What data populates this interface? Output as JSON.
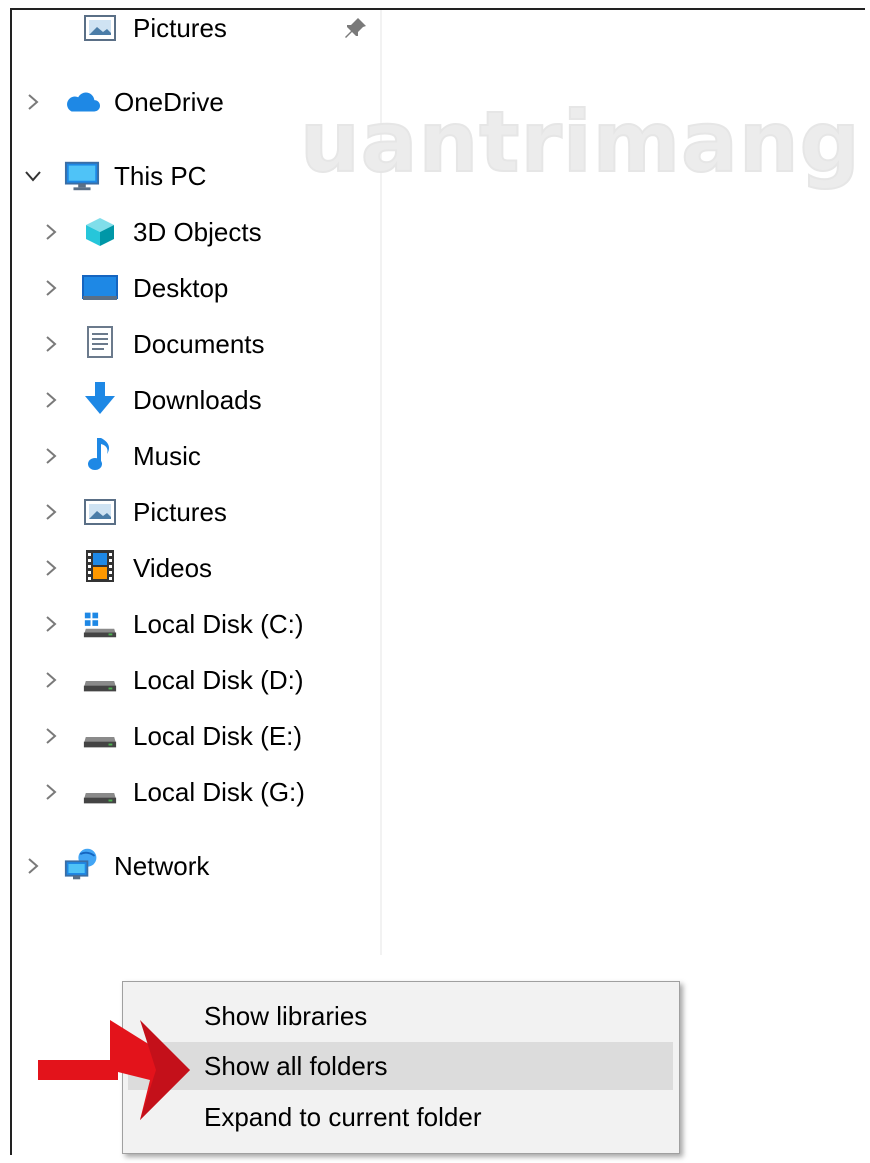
{
  "tree": {
    "items": [
      {
        "label": "Pictures",
        "icon": "pictures-icon",
        "pinned": true
      },
      {
        "label": "OneDrive",
        "icon": "onedrive-cloud-icon",
        "expanded": false
      },
      {
        "label": "This PC",
        "icon": "this-pc-icon",
        "expanded": true
      },
      {
        "label": "3D Objects",
        "icon": "3d-objects-icon"
      },
      {
        "label": "Desktop",
        "icon": "desktop-icon"
      },
      {
        "label": "Documents",
        "icon": "documents-icon"
      },
      {
        "label": "Downloads",
        "icon": "downloads-icon"
      },
      {
        "label": "Music",
        "icon": "music-icon"
      },
      {
        "label": "Pictures",
        "icon": "pictures-icon"
      },
      {
        "label": "Videos",
        "icon": "videos-icon"
      },
      {
        "label": "Local Disk (C:)",
        "icon": "system-drive-icon"
      },
      {
        "label": "Local Disk (D:)",
        "icon": "drive-icon"
      },
      {
        "label": "Local Disk (E:)",
        "icon": "drive-icon"
      },
      {
        "label": "Local Disk (G:)",
        "icon": "drive-icon"
      },
      {
        "label": "Network",
        "icon": "network-icon",
        "expanded": false
      }
    ]
  },
  "watermark": {
    "text": "uantrimang"
  },
  "context_menu": {
    "items": [
      {
        "label": "Show libraries",
        "highlighted": false
      },
      {
        "label": "Show all folders",
        "highlighted": true
      },
      {
        "label": "Expand to current folder",
        "highlighted": false
      }
    ]
  },
  "colors": {
    "accent_blue": "#1e88e5",
    "menu_bg": "#f2f2f2",
    "menu_highlight": "#dcdcdc",
    "arrow_red": "#e3131b"
  }
}
